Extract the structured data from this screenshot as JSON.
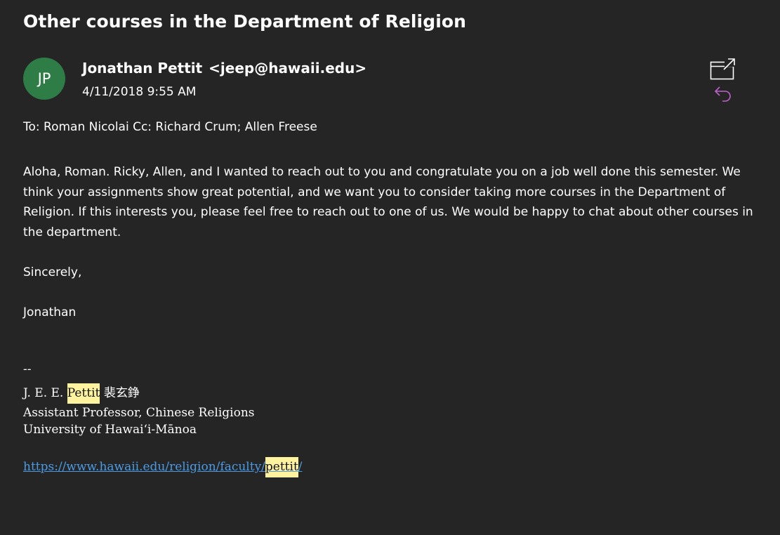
{
  "email": {
    "subject": "Other courses in the Department of Religion",
    "avatar_initials": "JP",
    "sender_name": "Jonathan Pettit",
    "sender_email": "<jeep@hawaii.edu>",
    "date": "4/11/2018 9:55 AM",
    "recipients": "To: Roman Nicolai Cc: Richard Crum; Allen Freese",
    "body": {
      "paragraph1": "Aloha, Roman. Ricky, Allen, and I wanted to reach out to you and congratulate you on a job well done this semester. We think your assignments show great potential, and we want you to consider taking more courses in the Department of Religion. If this interests you, please feel free to reach out to one of us. We would be happy to chat about other courses in the department.",
      "closing": "Sincerely,",
      "sign_off": "Jonathan"
    },
    "signature": {
      "dash": "--",
      "name_prefix": "J. E. E.",
      "name_highlight": "Pettit",
      "name_chinese": "裴玄錚",
      "title": "Assistant Professor, Chinese Religions",
      "university": "University of Hawaiʻi-Mānoa",
      "link_prefix": "https://www.hawaii.edu/religion/faculty/",
      "link_highlight": "pettit",
      "link_suffix": "/"
    }
  },
  "icons": {
    "popout": "popout-icon",
    "reply": "reply-icon"
  },
  "colors": {
    "background": "#252525",
    "avatar": "#2e7d46",
    "highlight": "#fff3a0",
    "link": "#4a9be5",
    "reply_icon": "#c061cb"
  }
}
